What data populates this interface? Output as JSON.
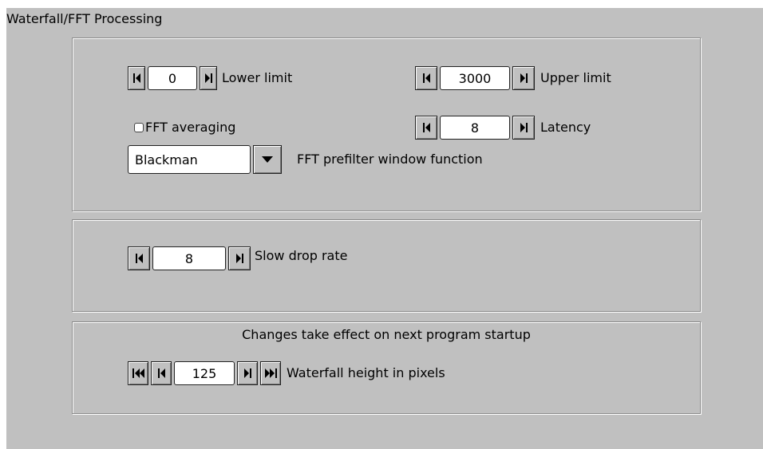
{
  "title": "Waterfall/FFT Processing",
  "fft": {
    "lower_limit": {
      "label": "Lower limit",
      "value": "0"
    },
    "upper_limit": {
      "label": "Upper limit",
      "value": "3000"
    },
    "averaging": {
      "label": "FFT averaging",
      "checked": false
    },
    "latency": {
      "label": "Latency",
      "value": "8"
    },
    "window_function": {
      "label": "FFT prefilter window function",
      "value": "Blackman"
    }
  },
  "drop": {
    "slow_drop_rate": {
      "label": "Slow drop rate",
      "value": "8"
    }
  },
  "startup": {
    "note": "Changes take effect on next program startup",
    "waterfall_height": {
      "label": "Waterfall height in pixels",
      "value": "125"
    }
  },
  "colors": {
    "panel": "#c0c0c0",
    "field": "#ffffff"
  },
  "icons": [
    "left-arrow-icon",
    "right-arrow-icon",
    "double-left-arrow-icon",
    "double-right-arrow-icon",
    "dropdown-arrow-icon",
    "checkbox-icon"
  ]
}
